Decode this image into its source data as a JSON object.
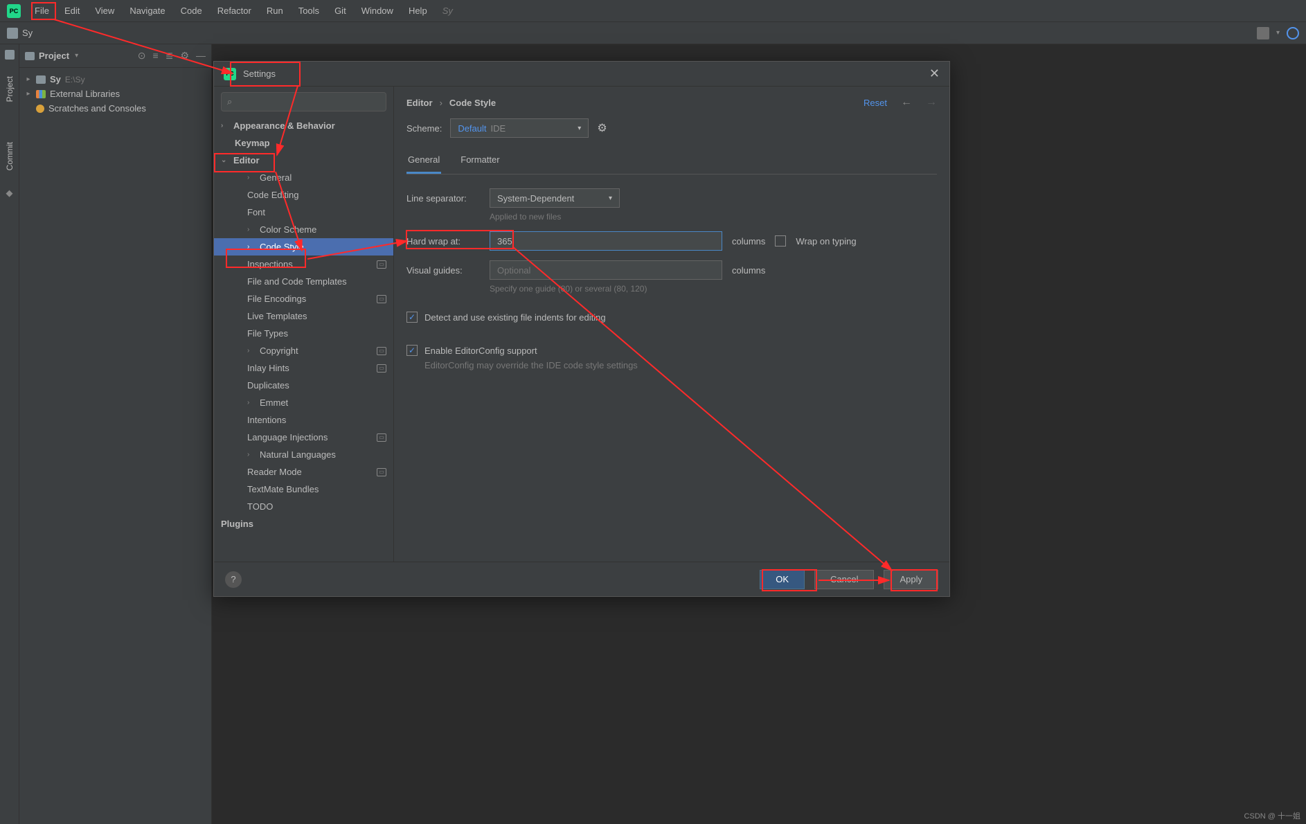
{
  "menubar": {
    "items": [
      "File",
      "Edit",
      "View",
      "Navigate",
      "Code",
      "Refactor",
      "Run",
      "Tools",
      "Git",
      "Window",
      "Help"
    ],
    "search_hint": "Sy"
  },
  "toolbar": {
    "project_name": "Sy"
  },
  "left_gutter": {
    "project": "Project",
    "commit": "Commit"
  },
  "project_pane": {
    "title": "Project",
    "root": {
      "name": "Sy",
      "path": "E:\\Sy"
    },
    "ext_lib": "External Libraries",
    "scratch": "Scratches and Consoles"
  },
  "settings": {
    "title": "Settings",
    "search_placeholder": "",
    "tree": {
      "appearance": "Appearance & Behavior",
      "keymap": "Keymap",
      "editor": "Editor",
      "editor_children": [
        "General",
        "Code Editing",
        "Font",
        "Color Scheme",
        "Code Style",
        "Inspections",
        "File and Code Templates",
        "File Encodings",
        "Live Templates",
        "File Types",
        "Copyright",
        "Inlay Hints",
        "Duplicates",
        "Emmet",
        "Intentions",
        "Language Injections",
        "Natural Languages",
        "Reader Mode",
        "TextMate Bundles",
        "TODO"
      ],
      "bottom": [
        "Plugins"
      ]
    },
    "breadcrumb": {
      "editor": "Editor",
      "code_style": "Code Style",
      "reset": "Reset"
    },
    "scheme": {
      "label": "Scheme:",
      "default": "Default",
      "ide": "IDE"
    },
    "tabs": {
      "general": "General",
      "formatter": "Formatter"
    },
    "fields": {
      "line_sep_label": "Line separator:",
      "line_sep_value": "System-Dependent",
      "line_sep_hint": "Applied to new files",
      "hard_wrap_label": "Hard wrap at:",
      "hard_wrap_value": "365",
      "visual_guides_label": "Visual guides:",
      "visual_guides_placeholder": "Optional",
      "visual_guides_hint": "Specify one guide (80) or several (80, 120)",
      "columns": "columns",
      "wrap_typing": "Wrap on typing",
      "detect_indents": "Detect and use existing file indents for editing",
      "editorconfig": "Enable EditorConfig support",
      "editorconfig_hint": "EditorConfig may override the IDE code style settings"
    },
    "buttons": {
      "ok": "OK",
      "cancel": "Cancel",
      "apply": "Apply"
    }
  },
  "watermark": "CSDN @ 十一姐"
}
